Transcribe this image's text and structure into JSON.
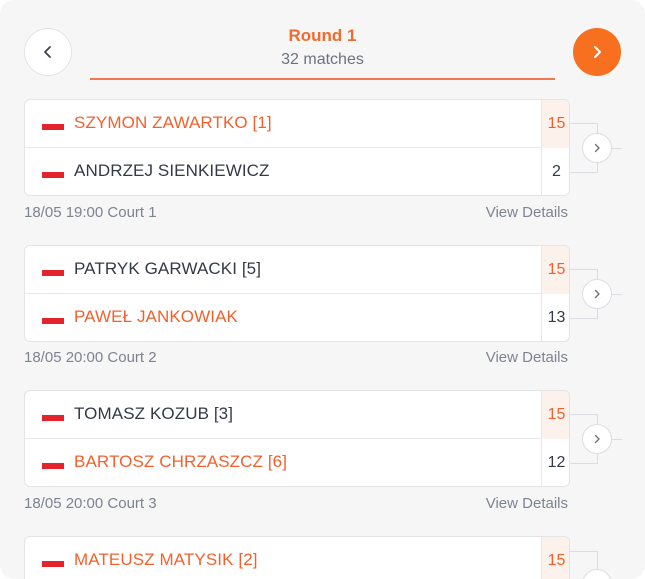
{
  "round": {
    "title": "Round 1",
    "subtitle": "32 matches"
  },
  "icons": {
    "prev": "chevron-left-icon",
    "next": "chevron-right-icon",
    "advance": "chevron-right-icon",
    "flag": "poland-flag-icon"
  },
  "colors": {
    "accent": "#f6701f",
    "winner": "#f2612d",
    "winner_score_bg": "#fdf1ec"
  },
  "matches": [
    {
      "players": [
        {
          "name": "SZYMON ZAWARTKO [1]",
          "score": "15",
          "winner": true
        },
        {
          "name": "ANDRZEJ SIENKIEWICZ",
          "score": "2",
          "winner": false
        }
      ],
      "when": "18/05 19:00 Court 1",
      "details_label": "View Details"
    },
    {
      "players": [
        {
          "name": "PATRYK GARWACKI [5]",
          "score": "15",
          "winner": false
        },
        {
          "name": "PAWEŁ JANKOWIAK",
          "score": "13",
          "winner": true
        }
      ],
      "when": "18/05 20:00 Court 2",
      "details_label": "View Details"
    },
    {
      "players": [
        {
          "name": "TOMASZ KOZUB [3]",
          "score": "15",
          "winner": false
        },
        {
          "name": "BARTOSZ CHRZASZCZ [6]",
          "score": "12",
          "winner": true
        }
      ],
      "when": "18/05 20:00 Court 3",
      "details_label": "View Details"
    },
    {
      "players": [
        {
          "name": "MATEUSZ MATYSIK [2]",
          "score": "15",
          "winner": true
        }
      ]
    }
  ]
}
